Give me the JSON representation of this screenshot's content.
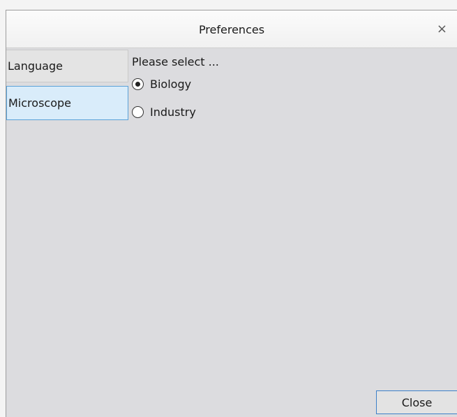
{
  "window": {
    "title": "Preferences",
    "close_glyph": "×"
  },
  "sidebar": {
    "items": [
      {
        "label": "Language",
        "selected": false
      },
      {
        "label": "Microscope",
        "selected": true
      }
    ]
  },
  "panel": {
    "heading": "Please select ...",
    "options": [
      {
        "label": "Biology",
        "checked": true
      },
      {
        "label": "Industry",
        "checked": false
      }
    ]
  },
  "footer": {
    "close_label": "Close"
  },
  "colors": {
    "selected_tab_bg": "#d9ecfa",
    "selected_tab_border": "#5aa1d8",
    "button_focus_border": "#3d80c9"
  },
  "icons": {
    "window_close": "close-icon",
    "radio_checked": "radio-checked-icon",
    "radio_unchecked": "radio-unchecked-icon"
  }
}
